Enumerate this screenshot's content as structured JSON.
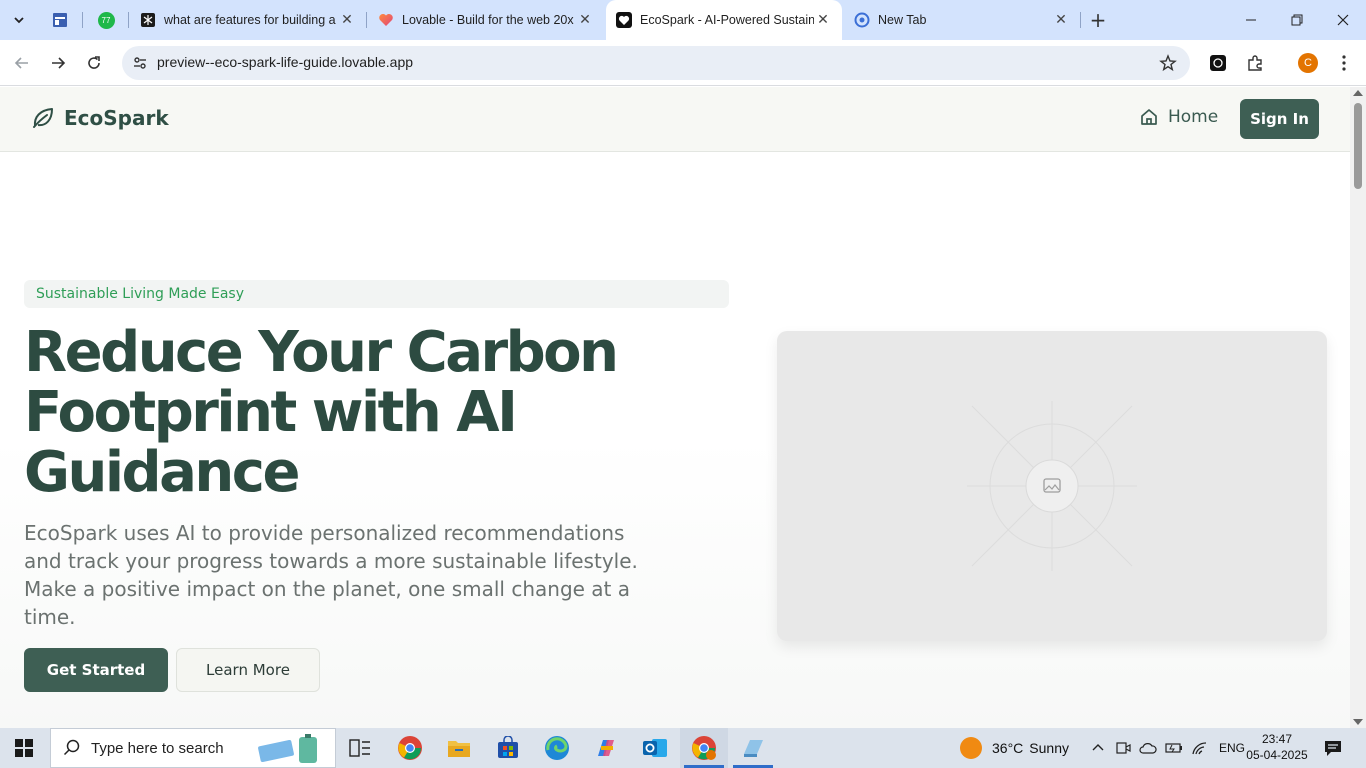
{
  "browser": {
    "tabs": [
      {
        "title": "what are features for building a",
        "favicon": "perplexity-icon"
      },
      {
        "title": "Lovable - Build for the web 20x",
        "favicon": "lovable-heart-icon"
      },
      {
        "title": "EcoSpark - AI-Powered Sustaina",
        "favicon": "heart-icon",
        "active": true
      },
      {
        "title": "New Tab",
        "favicon": "chrome-new-tab-icon"
      }
    ],
    "pinned_badge": "77",
    "url": "preview--eco-spark-life-guide.lovable.app",
    "profile_initial": "C"
  },
  "site": {
    "brand": "EcoSpark",
    "nav": {
      "home": "Home",
      "sign_in": "Sign In"
    },
    "hero": {
      "badge": "Sustainable Living Made Easy",
      "headline": "Reduce Your Carbon Footprint with AI Guidance",
      "description": "EcoSpark uses AI to provide personalized recommendations and track your progress towards a more sustainable lifestyle. Make a positive impact on the planet, one small change at a time.",
      "primary_cta": "Get Started",
      "secondary_cta": "Learn More"
    }
  },
  "taskbar": {
    "search_placeholder": "Type here to search",
    "weather": {
      "temp": "36°C",
      "condition": "Sunny"
    },
    "language": "ENG",
    "time": "23:47",
    "date": "05-04-2025"
  },
  "colors": {
    "brand_dark": "#2d4b41",
    "button": "#3e5f54",
    "badge_text": "#2f9e57",
    "tabstrip": "#d3e3fd"
  }
}
